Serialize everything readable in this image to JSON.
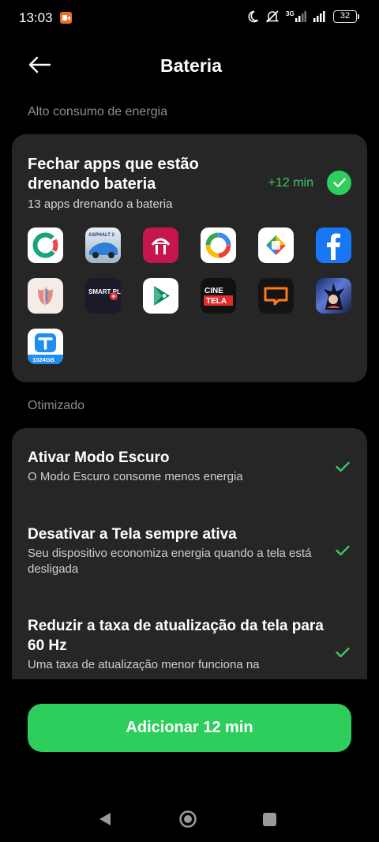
{
  "status": {
    "time": "13:03",
    "battery": "32",
    "network": "3G"
  },
  "header": {
    "title": "Bateria",
    "back_icon": "arrow-left-icon"
  },
  "high_usage": {
    "section_label": "Alto consumo de energia",
    "title": "Fechar apps que estão drenando bateria",
    "subtitle": "13 apps drenando a bateria",
    "gain": "+12 min",
    "apps": [
      {
        "name": "app-icon-c"
      },
      {
        "name": "app-icon-asphalt",
        "label": "ASPHALT 2"
      },
      {
        "name": "app-icon-bradesco"
      },
      {
        "name": "app-icon-google-one"
      },
      {
        "name": "app-icon-play-games"
      },
      {
        "name": "app-icon-facebook"
      },
      {
        "name": "app-icon-tulip"
      },
      {
        "name": "app-icon-smart-play",
        "label": "SMART PLAY"
      },
      {
        "name": "app-icon-play-games-2"
      },
      {
        "name": "app-icon-cine-tela",
        "label": "CINE TELA"
      },
      {
        "name": "app-icon-chat"
      },
      {
        "name": "app-icon-anime"
      },
      {
        "name": "app-icon-terabox",
        "label": "1024GB"
      }
    ]
  },
  "optimized": {
    "section_label": "Otimizado",
    "items": [
      {
        "title": "Ativar Modo Escuro",
        "desc": "O Modo Escuro consome menos energia"
      },
      {
        "title": "Desativar a Tela sempre ativa",
        "desc": "Seu dispositivo economiza energia quando a tela está desligada"
      },
      {
        "title": "Reduzir a taxa de atualização da tela para 60 Hz",
        "desc": "Uma taxa de atualização menor funciona na"
      }
    ]
  },
  "action": {
    "label": "Adicionar 12 min"
  },
  "colors": {
    "accent": "#2dce5b",
    "card": "#262626",
    "background": "#000000"
  }
}
